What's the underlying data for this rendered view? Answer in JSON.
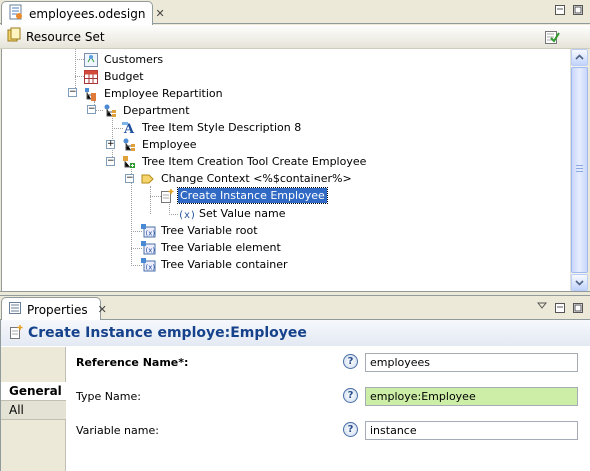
{
  "editor": {
    "tab_label": "employees.odesign",
    "resource_set_label": "Resource Set"
  },
  "tree": {
    "items": [
      {
        "label": "Customers",
        "icon": "customers-icon"
      },
      {
        "label": "Budget",
        "icon": "table-icon"
      },
      {
        "label": "Employee Repartition",
        "icon": "tree-repartition-icon"
      },
      {
        "label": "Department",
        "icon": "tree-mapping-icon"
      },
      {
        "label": "Tree Item Style Description 8",
        "icon": "style-icon"
      },
      {
        "label": "Employee",
        "icon": "tree-mapping-icon"
      },
      {
        "label": "Tree Item Creation Tool Create Employee",
        "icon": "creation-tool-icon"
      },
      {
        "label": "Change Context <%$container%>",
        "icon": "change-context-icon"
      },
      {
        "label": "Create Instance Employee",
        "icon": "create-instance-icon",
        "selected": true
      },
      {
        "label": "Set Value name",
        "icon": "set-value-icon"
      },
      {
        "label": "Tree Variable root",
        "icon": "variable-icon"
      },
      {
        "label": "Tree Variable element",
        "icon": "variable-icon"
      },
      {
        "label": "Tree Variable container",
        "icon": "variable-icon"
      }
    ]
  },
  "properties": {
    "tab_label": "Properties",
    "title": "Create Instance employe:Employee",
    "side_tabs": [
      {
        "label": "General",
        "active": true
      },
      {
        "label": "All",
        "active": false
      }
    ],
    "fields": [
      {
        "label": "Reference Name*:",
        "value": "employees",
        "bold": true
      },
      {
        "label": "Type Name:",
        "value": "employe:Employee",
        "bold": false
      },
      {
        "label": "Variable name:",
        "value": "instance",
        "bold": false
      }
    ]
  },
  "colors": {
    "selection": "#316ac5",
    "title_text": "#15428b",
    "type_name_bg": "#cdeea7"
  }
}
